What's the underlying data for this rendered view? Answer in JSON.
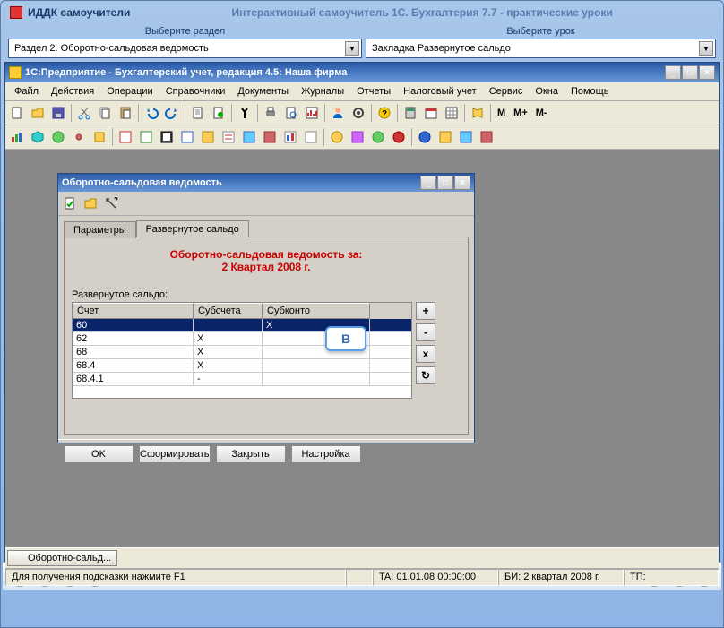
{
  "outer": {
    "app_name": "ИДДК самоучители",
    "title": "Интерактивный самоучитель 1С. Бухгалтерия 7.7 - практические уроки"
  },
  "selectors": {
    "section_label": "Выберите раздел",
    "lesson_label": "Выберите урок",
    "section_value": "Раздел 2. Оборотно-сальдовая ведомость",
    "lesson_value": "Закладка Развернутое сальдо"
  },
  "app": {
    "title": "1С:Предприятие - Бухгалтерский учет, редакция 4.5: Наша фирма",
    "menus": [
      "Файл",
      "Действия",
      "Операции",
      "Справочники",
      "Документы",
      "Журналы",
      "Отчеты",
      "Налоговый учет",
      "Сервис",
      "Окна",
      "Помощь"
    ],
    "m_labels": [
      "M",
      "M+",
      "M-"
    ]
  },
  "dialog": {
    "title": "Оборотно-сальдовая ведомость",
    "tabs": {
      "params": "Параметры",
      "expanded": "Развернутое сальдо"
    },
    "report_title_1": "Оборотно-сальдовая ведомость за:",
    "report_title_2": "2 Квартал 2008 г.",
    "field_label": "Развернутое сальдо:",
    "columns": {
      "acct": "Счет",
      "sub": "Субсчета",
      "subk": "Субконто"
    },
    "rows": [
      {
        "acct": "60",
        "sub": "",
        "subk": "X",
        "sel": true
      },
      {
        "acct": "62",
        "sub": "X",
        "subk": ""
      },
      {
        "acct": "68",
        "sub": "X",
        "subk": ""
      },
      {
        "acct": "68.4",
        "sub": "X",
        "subk": ""
      },
      {
        "acct": "68.4.1",
        "sub": "-",
        "subk": ""
      }
    ],
    "side_btns": {
      "add": "+",
      "del": "-",
      "x": "x",
      "ref": "↻"
    },
    "buttons": {
      "ok": "OK",
      "form": "Сформировать",
      "close": "Закрыть",
      "setup": "Настройка"
    }
  },
  "callout": "В",
  "taskbar": {
    "item": "Оборотно-сальд..."
  },
  "status": {
    "hint": "Для получения подсказки нажмите F1",
    "ta": "TA: 01.01.08   00:00:00",
    "bi": "БИ: 2 квартал 2008 г.",
    "tp": "ТП:"
  }
}
